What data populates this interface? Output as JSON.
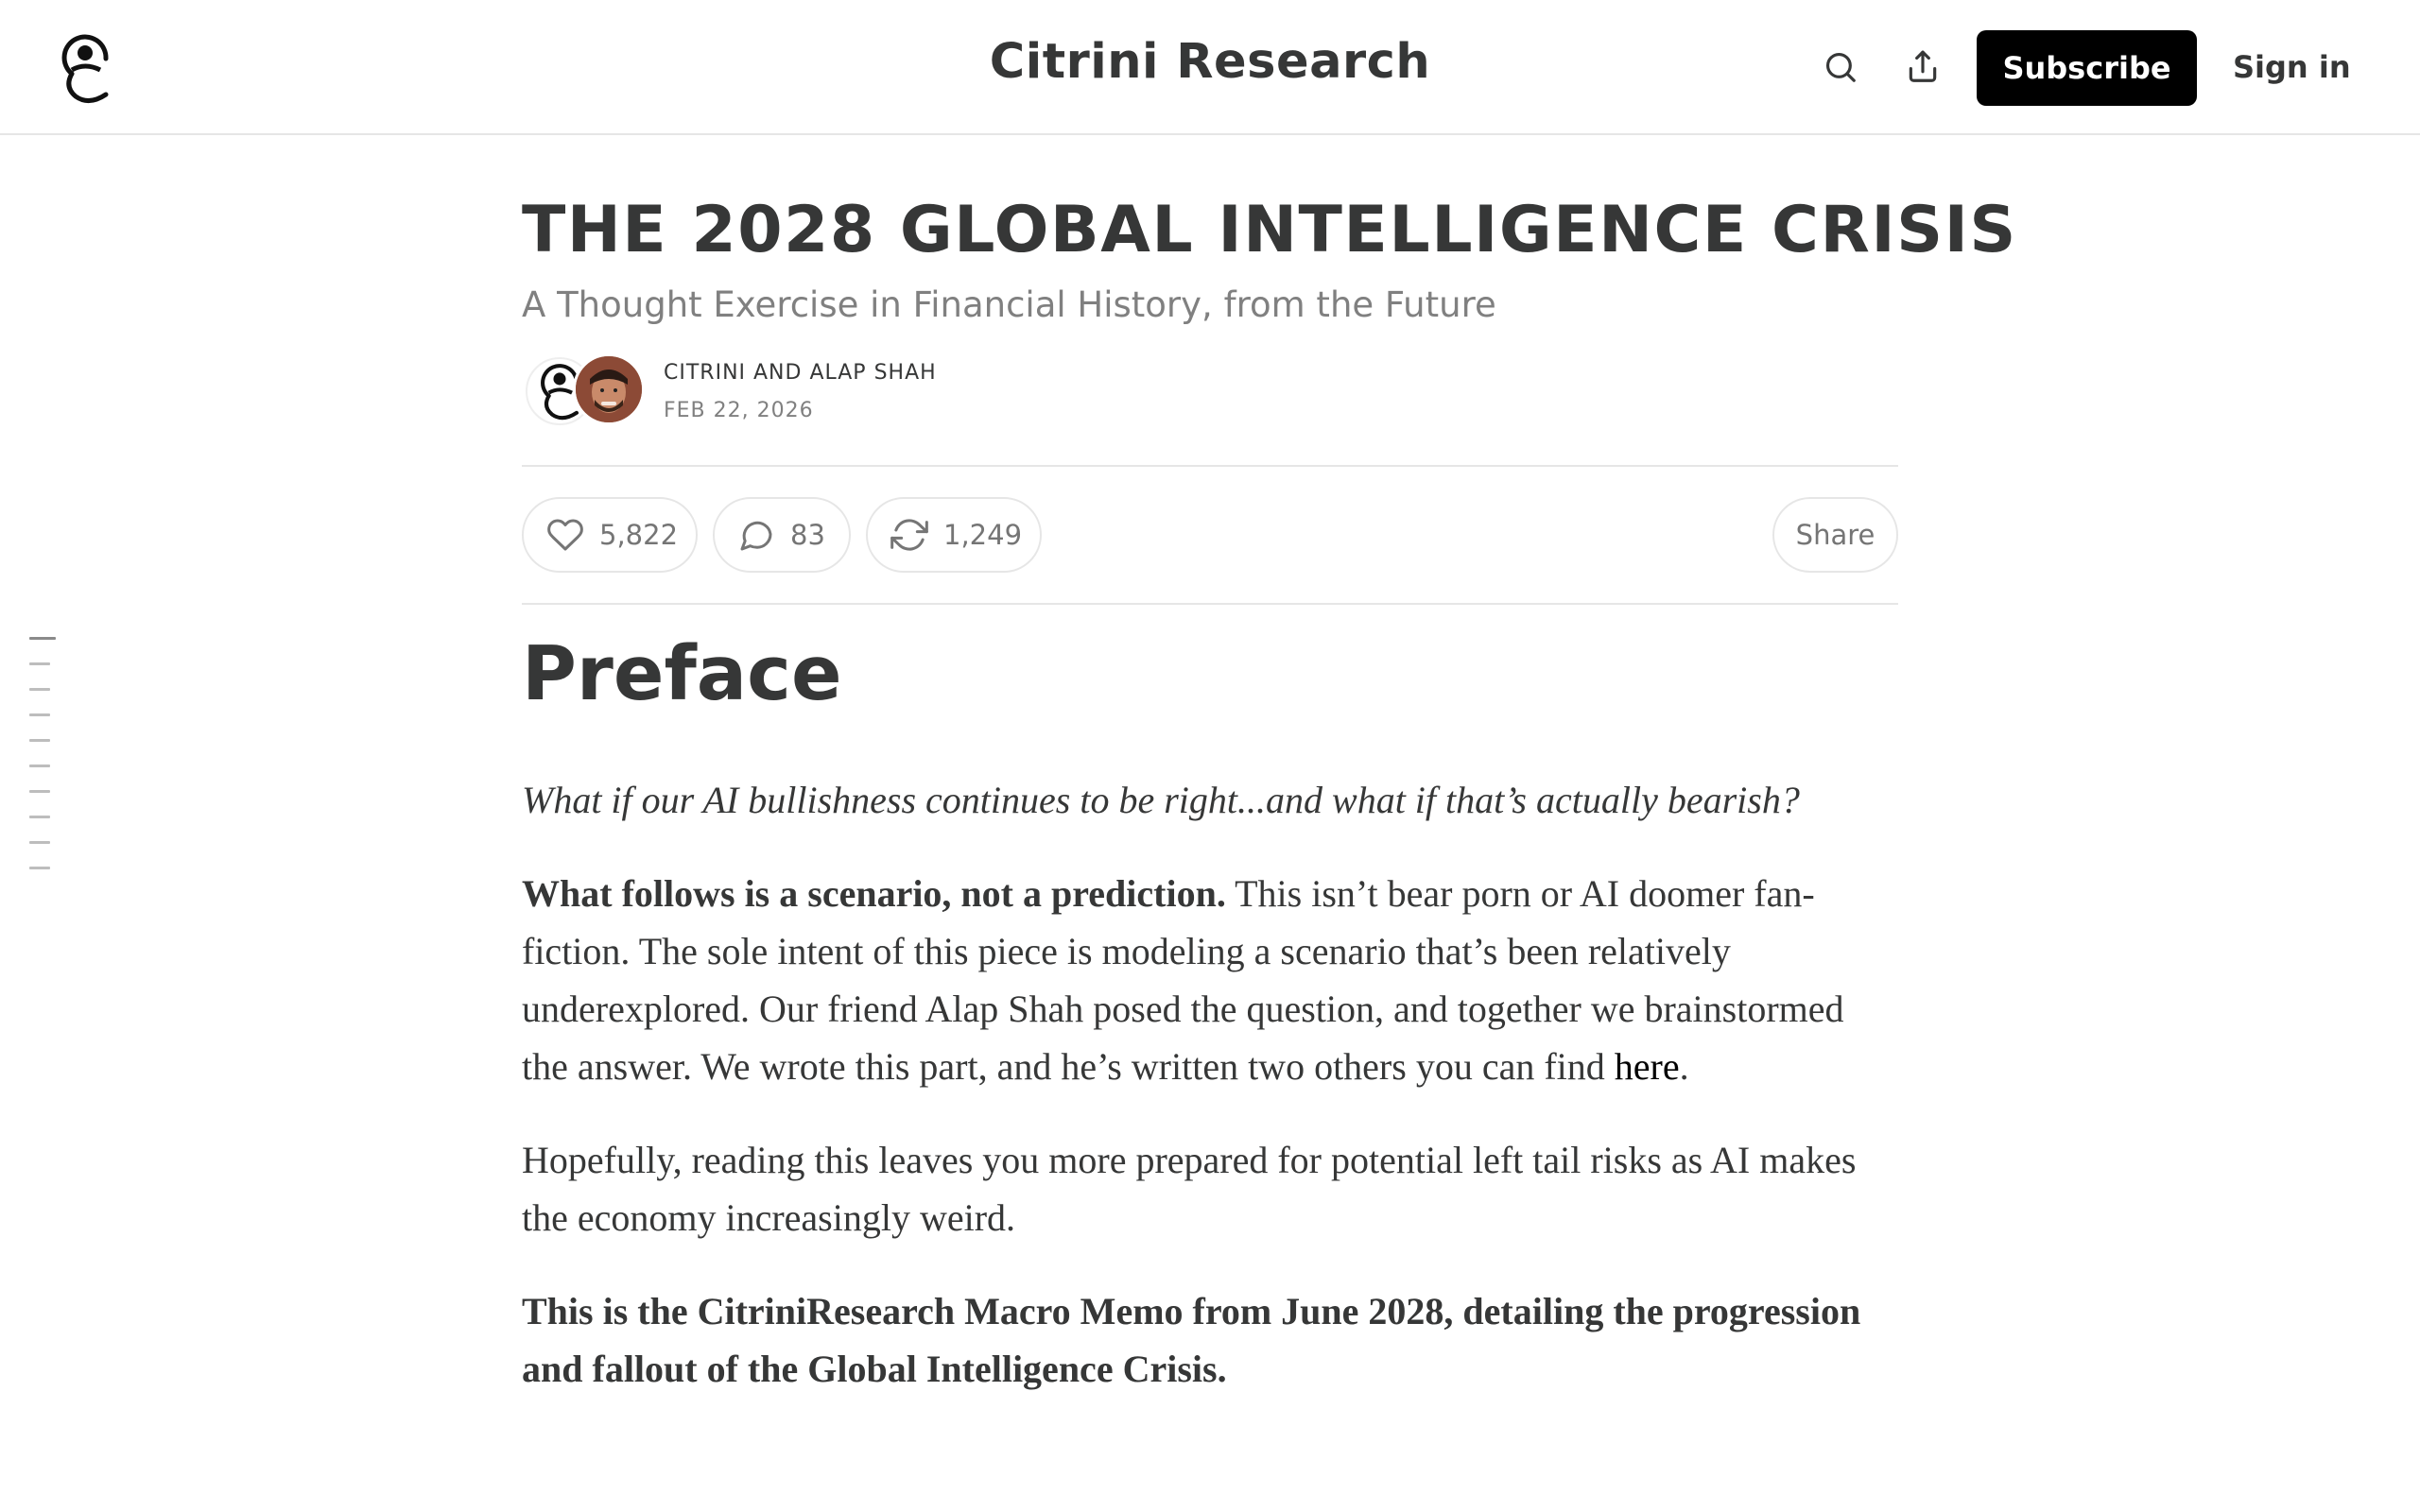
{
  "header": {
    "publication": "Citrini Research",
    "logo_icon": "citrini-logo-icon",
    "search_icon": "search-icon",
    "share_icon": "share-upload-icon",
    "subscribe_label": "Subscribe",
    "signin_label": "Sign in"
  },
  "post": {
    "title": "THE 2028 GLOBAL INTELLIGENCE CRISIS",
    "subtitle": "A Thought Exercise in Financial History, from the Future",
    "authors": "CITRINI AND ALAP SHAH",
    "date": "FEB 22, 2026"
  },
  "actions": {
    "likes": "5,822",
    "comments": "83",
    "restacks": "1,249",
    "share_label": "Share"
  },
  "toc": {
    "item_count": 10
  },
  "content": {
    "heading": "Preface",
    "p1": "What if our AI bullishness continues to be right...and what if that’s actually bearish?",
    "p2_bold": "What follows is a scenario, not a prediction.",
    "p2_rest": " This isn’t bear porn or AI doomer fan-fiction. The sole intent of this piece is modeling a scenario that’s been relatively underexplored. Our friend Alap Shah posed the question, and together we brainstormed the answer. We wrote this part, and he’s written two others you can find ",
    "p2_link": "here",
    "p2_end": ".",
    "p3": "Hopefully, reading this leaves you more prepared for potential left tail risks as AI makes the economy increasingly weird.",
    "p4": "This is the CitriniResearch Macro Memo from June 2028, detailing the progression and fallout of the Global Intelligence Crisis."
  },
  "colors": {
    "text": "#363737",
    "muted": "#808080",
    "border": "#e6e6e6",
    "button_bg": "#000000"
  }
}
